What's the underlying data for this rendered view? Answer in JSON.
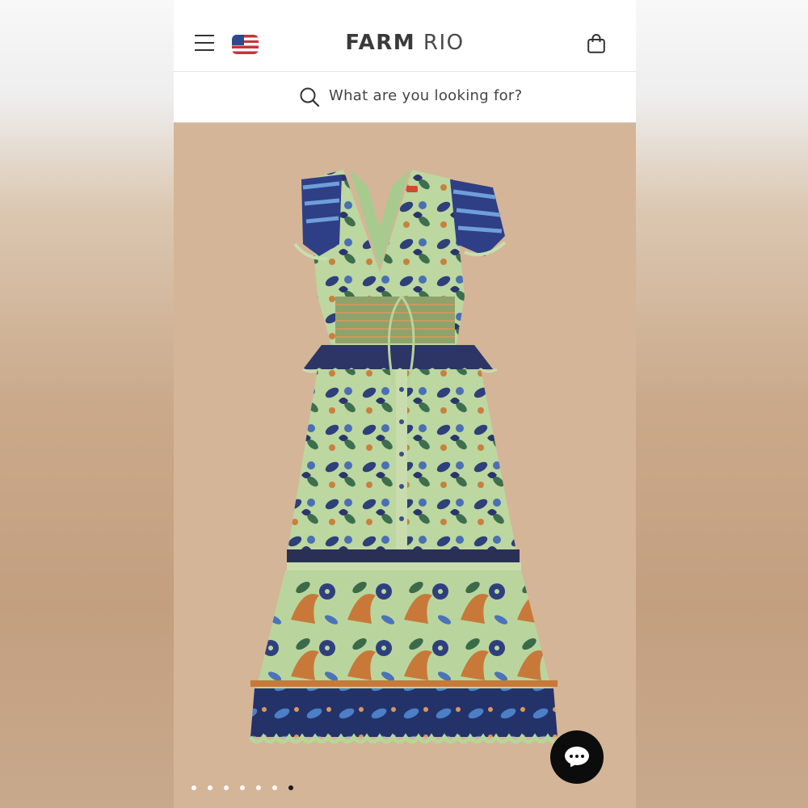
{
  "header": {
    "brand_primary": "FARM",
    "brand_secondary": "RIO",
    "menu_icon": "hamburger-menu-icon",
    "flag_icon": "us-flag-icon",
    "bag_icon": "shopping-bag-icon"
  },
  "search": {
    "placeholder": "What are you looking for?",
    "icon": "search-icon"
  },
  "gallery": {
    "dot_count": 7,
    "active_index": 6
  },
  "colors": {
    "background": "#d4b597",
    "dress_green": "#bfd9a4",
    "dress_navy": "#2b3a73",
    "dress_orange": "#c87a3e",
    "chat_button": "#0c0c0c"
  },
  "chat": {
    "icon": "chat-bubble-icon"
  }
}
